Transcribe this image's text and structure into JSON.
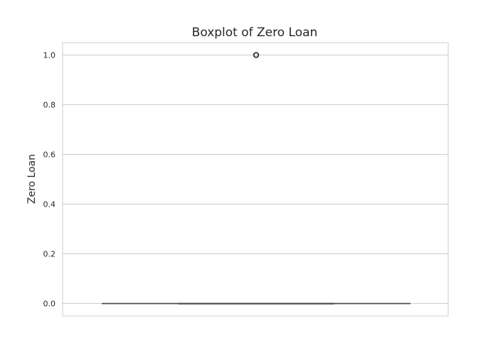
{
  "chart_data": {
    "type": "box",
    "title": "Boxplot of Zero Loan",
    "xlabel": "",
    "ylabel": "Zero Loan",
    "ylim": [
      -0.05,
      1.05
    ],
    "yticks": [
      0.0,
      0.2,
      0.4,
      0.6,
      0.8,
      1.0
    ],
    "ytick_labels": [
      "0.0",
      "0.2",
      "0.4",
      "0.6",
      "0.8",
      "1.0"
    ],
    "grid": true,
    "box": {
      "min": 0.0,
      "q1": 0.0,
      "median": 0.0,
      "q3": 0.0,
      "max": 0.0,
      "outliers": [
        1.0
      ]
    },
    "colors": {
      "grid": "#cccccc",
      "spine": "#cccccc",
      "box_line": "#4d4d4d",
      "outlier_edge": "#3f3f3f",
      "text": "#262626"
    }
  }
}
